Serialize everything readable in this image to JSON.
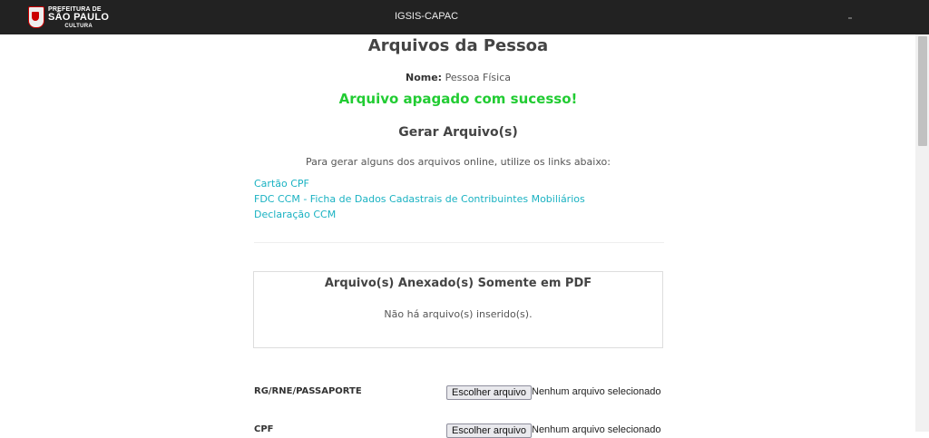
{
  "header": {
    "logo_line1": "PREFEITURA DE",
    "logo_line2": "SÃO PAULO",
    "logo_line3": "CULTURA",
    "app_title": "IGSIS-CAPAC"
  },
  "page": {
    "title": "Arquivos da Pessoa",
    "name_label": "Nome:",
    "name_value": "Pessoa Física",
    "success_message": "Arquivo apagado com sucesso!"
  },
  "generate": {
    "title": "Gerar Arquivo(s)",
    "instructions": "Para gerar alguns dos arquivos online, utilize os links abaixo:",
    "links": [
      "Cartão CPF",
      "FDC CCM - Ficha de Dados Cadastrais de Contribuintes Mobiliários",
      "Declaração CCM"
    ]
  },
  "attached": {
    "title": "Arquivo(s) Anexado(s) Somente em PDF",
    "empty_message": "Não há arquivo(s) inserido(s)."
  },
  "uploads": [
    {
      "label": "RG/RNE/PASSAPORTE",
      "button": "Escolher arquivo",
      "status": "Nenhum arquivo selecionado"
    },
    {
      "label": "CPF",
      "button": "Escolher arquivo",
      "status": "Nenhum arquivo selecionado"
    }
  ],
  "colors": {
    "topbar": "#222222",
    "success": "#22cc33",
    "link": "#1ab2c2"
  }
}
